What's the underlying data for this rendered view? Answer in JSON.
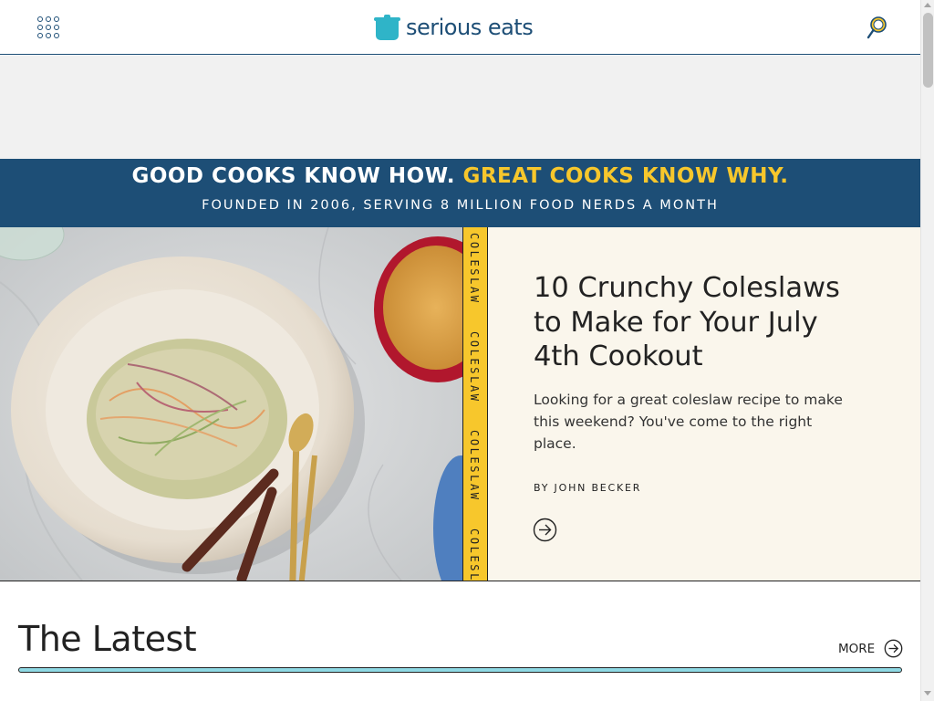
{
  "header": {
    "logo_text": "serious eats",
    "menu_icon": "grid-menu-icon",
    "search_icon": "search-icon",
    "accent_color": "#1d4e76",
    "logo_color": "#2fb4c8"
  },
  "banner": {
    "tagline_part1": "GOOD COOKS KNOW HOW.",
    "tagline_part2": "GREAT COOKS KNOW WHY.",
    "subline": "FOUNDED IN 2006, SERVING 8 MILLION FOOD NERDS A MONTH",
    "bg_color": "#1d4e76",
    "highlight_color": "#f7c72c"
  },
  "hero": {
    "tag": "COLESLAW",
    "title": "10 Crunchy Coleslaws to Make for Your July 4th Cookout",
    "description": "Looking for a great coleslaw recipe to make this weekend? You've come to the right place.",
    "byline": "BY JOHN BECKER",
    "arrow_icon": "arrow-right-circle-icon",
    "image_alt": "coleslaw-bowl-photo"
  },
  "latest": {
    "title": "The Latest",
    "more_label": "MORE",
    "more_icon": "arrow-right-circle-icon"
  }
}
